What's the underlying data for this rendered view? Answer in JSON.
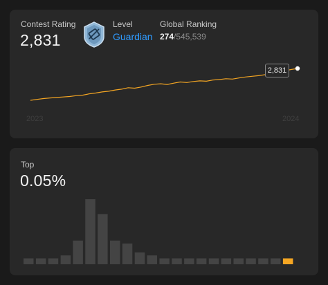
{
  "rating_card": {
    "contest_rating_label": "Contest Rating",
    "contest_rating_value": "2,831",
    "level_label": "Level",
    "level_value": "Guardian",
    "global_ranking_label": "Global Ranking",
    "global_rank": "274",
    "global_total": "/545,539",
    "tooltip_value": "2,831",
    "year_start": "2023",
    "year_end": "2024",
    "badge_icon": "guardian-badge-icon"
  },
  "top_card": {
    "top_label": "Top",
    "top_value": "0.05%"
  },
  "colors": {
    "accent": "#f5a623",
    "level": "#2f9bff",
    "bar": "#444444",
    "card": "#282828",
    "background": "#1a1a1a"
  },
  "chart_data": [
    {
      "type": "line",
      "x": [
        "2023",
        "2024"
      ],
      "series": [
        {
          "values": [
            1852,
            1880,
            1905,
            1925,
            1940,
            1955,
            1970,
            1995,
            2010,
            2050,
            2075,
            2110,
            2130,
            2170,
            2195,
            2240,
            2225,
            2260,
            2310,
            2345,
            2360,
            2340,
            2380,
            2415,
            2400,
            2430,
            2450,
            2440,
            2475,
            2490,
            2515,
            2505,
            2540,
            2570,
            2590,
            2610,
            2640,
            2665,
            2710,
            2760,
            2800,
            2831
          ]
        }
      ]
    },
    {
      "type": "bar",
      "values": [
        2,
        2,
        2,
        3,
        8,
        22,
        17,
        8,
        7,
        4,
        3,
        2,
        2,
        2,
        2,
        2,
        2,
        2,
        2,
        2,
        2,
        2
      ],
      "highlight_index": 21
    }
  ]
}
